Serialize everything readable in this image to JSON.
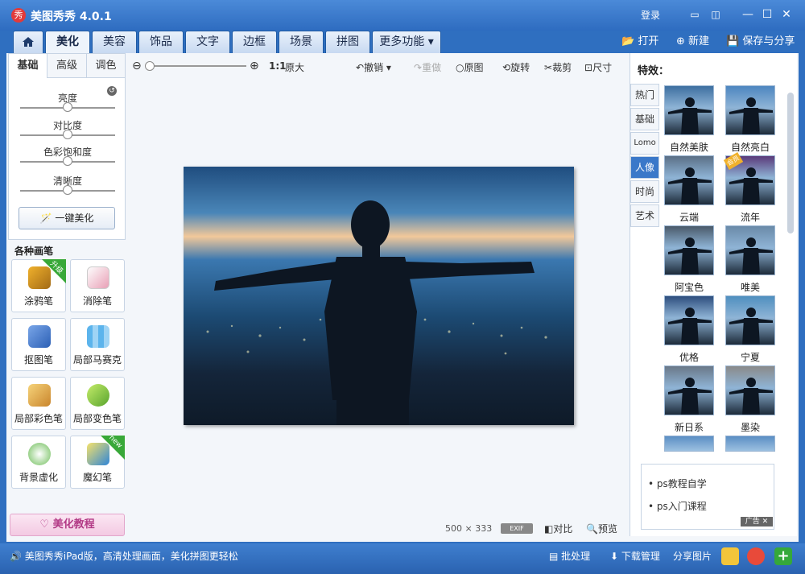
{
  "app": {
    "logo": "秀",
    "title": "美图秀秀 4.0.1",
    "login": "登录"
  },
  "window": {
    "chat_icon": "chat-icon",
    "skin_icon": "skin-icon",
    "minimize": "—",
    "maximize": "☐",
    "close": "✕"
  },
  "nav": {
    "home_icon": "home-icon",
    "tabs": [
      "美化",
      "美容",
      "饰品",
      "文字",
      "边框",
      "场景",
      "拼图"
    ],
    "more": "更多功能",
    "open": "打开",
    "new": "新建",
    "save": "保存与分享"
  },
  "left": {
    "sub_tabs": [
      "基础",
      "高级",
      "调色"
    ],
    "sliders": [
      {
        "label": "亮度",
        "value": 0.5
      },
      {
        "label": "对比度",
        "value": 0.5
      },
      {
        "label": "色彩饱和度",
        "value": 0.5
      },
      {
        "label": "清晰度",
        "value": 0.5
      }
    ],
    "auto_button": "一键美化",
    "brush_title": "各种画笔",
    "brushes": [
      {
        "label": "涂鸦笔",
        "badge": "升级",
        "icon": "crayon-icon"
      },
      {
        "label": "消除笔",
        "badge": "",
        "icon": "eraser-icon"
      },
      {
        "label": "抠图笔",
        "badge": "",
        "icon": "cutout-pen-icon"
      },
      {
        "label": "局部马赛克",
        "badge": "",
        "icon": "mosaic-icon"
      },
      {
        "label": "局部彩色笔",
        "badge": "",
        "icon": "color-brush-icon"
      },
      {
        "label": "局部变色笔",
        "badge": "",
        "icon": "paint-bucket-icon"
      },
      {
        "label": "背景虚化",
        "badge": "",
        "icon": "blur-icon"
      },
      {
        "label": "魔幻笔",
        "badge": "new",
        "icon": "magic-pen-icon"
      }
    ],
    "tutorial": "美化教程"
  },
  "toolbar": {
    "zoom_ratio": "1:1",
    "original_size": "原大",
    "undo": "撤销",
    "redo": "重做",
    "original": "原图",
    "rotate": "旋转",
    "crop": "裁剪",
    "size": "尺寸",
    "zoom_level": 0.0
  },
  "canvas": {
    "width": "500",
    "times": "×",
    "height": "333",
    "exif": "EXIF",
    "compare": "对比",
    "preview": "预览"
  },
  "effects": {
    "title": "特效：",
    "categories": [
      "热门",
      "基础",
      "Lomo",
      "人像",
      "时尚",
      "艺术"
    ],
    "active_category": "人像",
    "items": [
      "自然美肤",
      "自然亮白",
      "云端",
      "流年",
      "阿宝色",
      "唯美",
      "优格",
      "宁夏",
      "新日系",
      "墨染"
    ],
    "member_badge": "会员"
  },
  "news": {
    "items": [
      "ps教程自学",
      "ps入门课程"
    ],
    "ad": "广告"
  },
  "status": {
    "text": "美图秀秀iPad版，高清处理画面，美化拼图更轻松",
    "batch": "批处理",
    "download": "下载管理",
    "share": "分享图片"
  },
  "colors": {
    "accent": "#2f6fc0",
    "active_tab": "#3a78c9",
    "badge_green": "#38a838"
  }
}
